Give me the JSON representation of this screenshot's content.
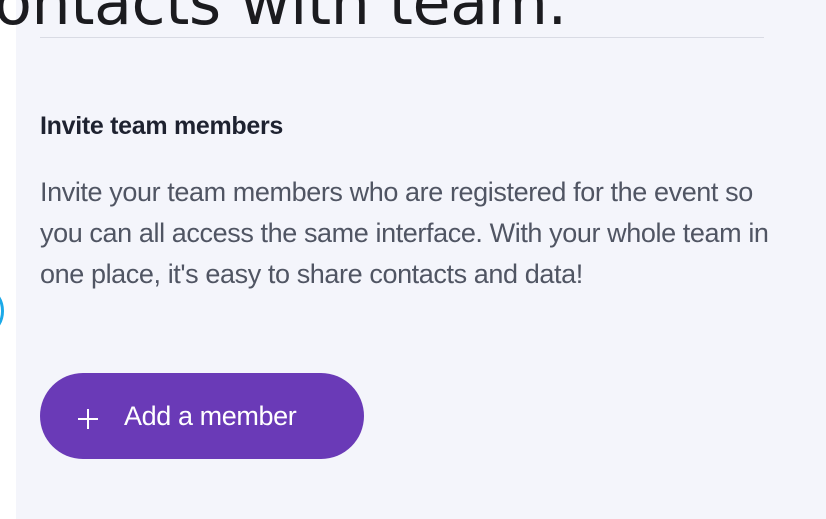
{
  "page_heading_fragment": "ontacts with team.",
  "invite_card": {
    "title": "Invite team members",
    "description": "Invite your team members who are registered for the event so you can all access the same interface. With your whole team in one place, it's easy to share contacts and data!",
    "add_button": {
      "label": "Add a member",
      "icon": "plus-icon"
    }
  },
  "colors": {
    "accent_button": "#6a3ab7",
    "panel_background": "#f4f5fb",
    "title_text": "#1e2230",
    "body_text": "#505563",
    "edge_marker": "#1ba9e8"
  }
}
